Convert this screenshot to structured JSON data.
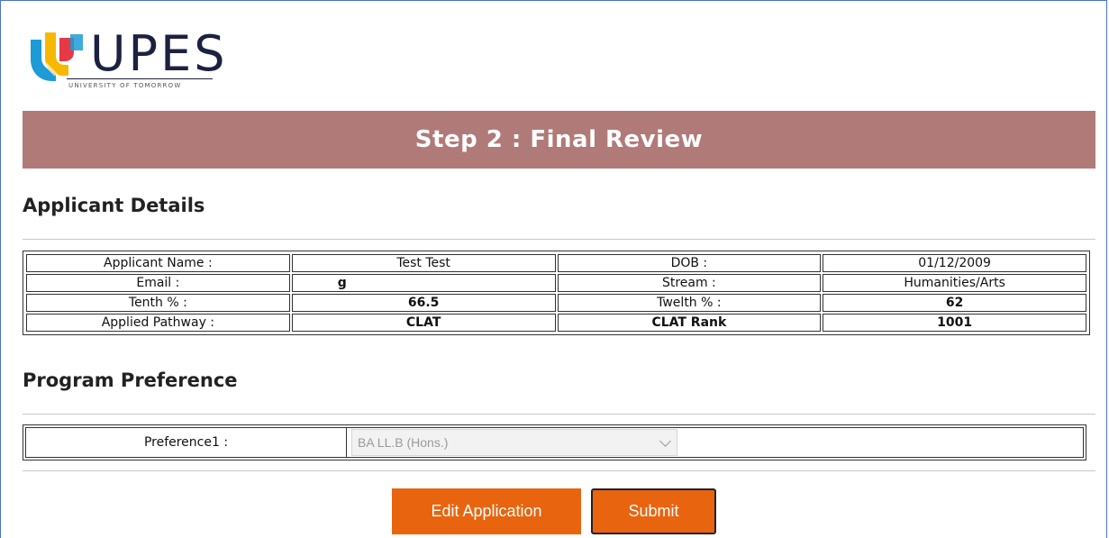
{
  "brand": {
    "wordmark": "UPES",
    "tagline": "UNIVERSITY OF TOMORROW",
    "colors": {
      "red": "#e63946",
      "yellow": "#f6b800",
      "blue": "#1d9bd7",
      "navy": "#1c2140"
    }
  },
  "banner": {
    "title": "Step 2 : Final Review",
    "color": "#b07a78"
  },
  "applicant": {
    "heading": "Applicant Details",
    "rows": [
      {
        "label1": "Applicant Name :",
        "value1": "Test Test",
        "label2": "DOB :",
        "value2": "01/12/2009"
      },
      {
        "label1": "Email :",
        "value1": "g",
        "label2": "Stream :",
        "value2": "Humanities/Arts"
      },
      {
        "label1": "Tenth % :",
        "value1": "66.5",
        "label2": "Twelth % :",
        "value2": "62"
      },
      {
        "label1": "Applied Pathway :",
        "value1": "CLAT",
        "label2": "CLAT Rank",
        "value2": "1001"
      }
    ]
  },
  "program": {
    "heading": "Program Preference",
    "preference_label": "Preference1 :",
    "preference_value": "BA LL.B (Hons.)"
  },
  "actions": {
    "edit_label": "Edit Application",
    "submit_label": "Submit",
    "button_color": "#e8640f"
  }
}
